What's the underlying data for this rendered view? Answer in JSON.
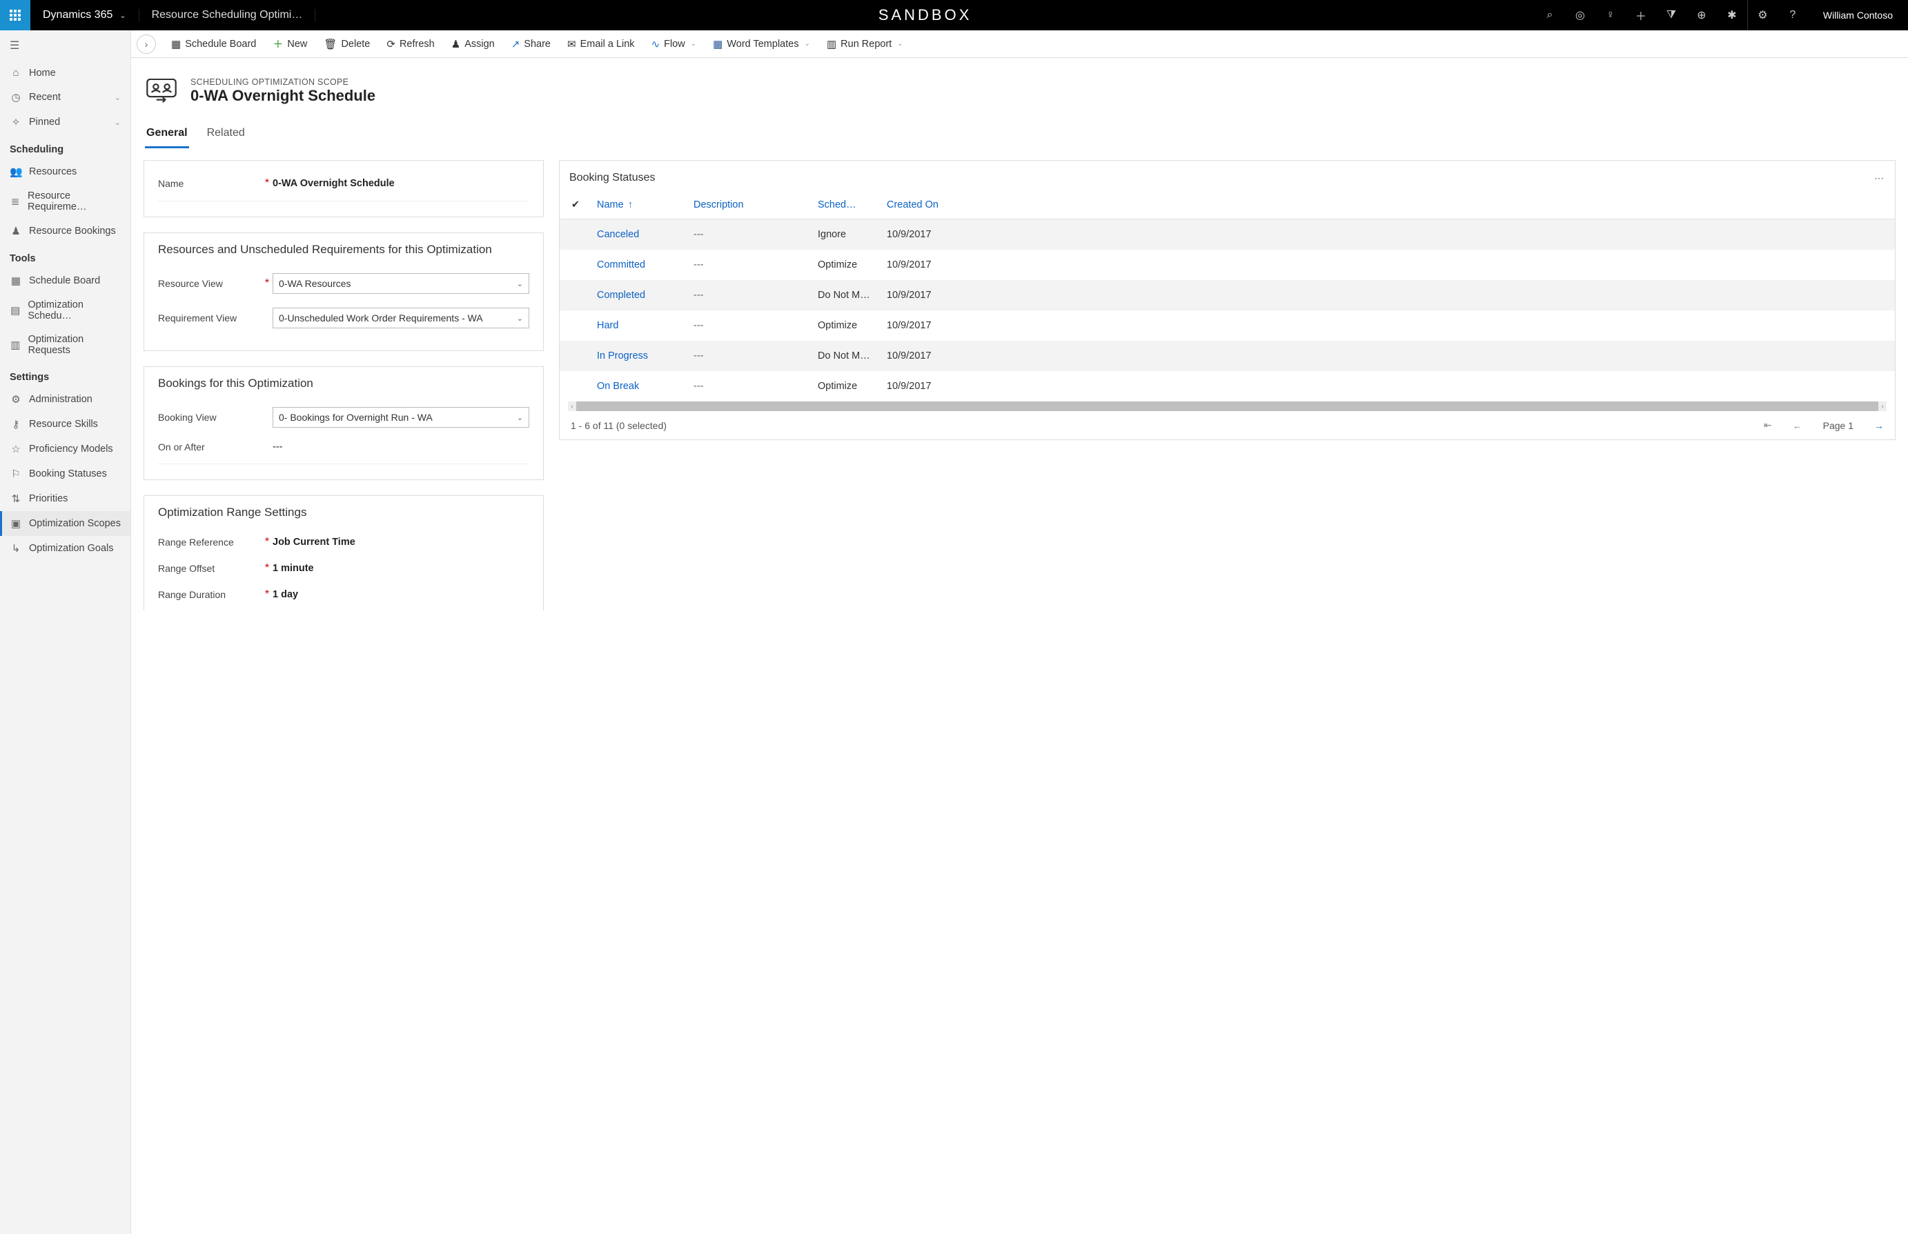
{
  "topbar": {
    "brand": "Dynamics 365",
    "breadcrumb": "Resource Scheduling Optimi…",
    "env": "SANDBOX",
    "user": "William Contoso"
  },
  "cmdbar": {
    "schedule_board": "Schedule Board",
    "new": "New",
    "delete": "Delete",
    "refresh": "Refresh",
    "assign": "Assign",
    "share": "Share",
    "email_link": "Email a Link",
    "flow": "Flow",
    "word_templates": "Word Templates",
    "run_report": "Run Report"
  },
  "nav": {
    "home": "Home",
    "recent": "Recent",
    "pinned": "Pinned",
    "group_scheduling": "Scheduling",
    "resources": "Resources",
    "resource_requirements": "Resource Requireme…",
    "resource_bookings": "Resource Bookings",
    "group_tools": "Tools",
    "schedule_board": "Schedule Board",
    "optimization_schedules": "Optimization Schedu…",
    "optimization_requests": "Optimization Requests",
    "group_settings": "Settings",
    "administration": "Administration",
    "resource_skills": "Resource Skills",
    "proficiency_models": "Proficiency Models",
    "booking_statuses": "Booking Statuses",
    "priorities": "Priorities",
    "optimization_scopes": "Optimization Scopes",
    "optimization_goals": "Optimization Goals"
  },
  "record": {
    "entity": "SCHEDULING OPTIMIZATION SCOPE",
    "title": "0-WA Overnight Schedule"
  },
  "tabs": {
    "general": "General",
    "related": "Related"
  },
  "form": {
    "name_label": "Name",
    "name_value": "0-WA Overnight Schedule",
    "sec_resources_title": "Resources and Unscheduled Requirements for this Optimization",
    "resource_view_label": "Resource View",
    "resource_view_value": "0-WA Resources",
    "requirement_view_label": "Requirement View",
    "requirement_view_value": "0-Unscheduled Work Order Requirements - WA",
    "sec_bookings_title": "Bookings for this Optimization",
    "booking_view_label": "Booking View",
    "booking_view_value": "0- Bookings for Overnight Run - WA",
    "on_or_after_label": "On or After",
    "on_or_after_value": "---",
    "sec_range_title": "Optimization Range Settings",
    "range_ref_label": "Range Reference",
    "range_ref_value": "Job Current Time",
    "range_offset_label": "Range Offset",
    "range_offset_value": "1 minute",
    "range_duration_label": "Range Duration",
    "range_duration_value": "1 day"
  },
  "subgrid": {
    "title": "Booking Statuses",
    "col_name": "Name",
    "col_desc": "Description",
    "col_sched": "Sched…",
    "col_created": "Created On",
    "rows": [
      {
        "name": "Canceled",
        "desc": "---",
        "sched": "Ignore",
        "created": "10/9/2017"
      },
      {
        "name": "Committed",
        "desc": "---",
        "sched": "Optimize",
        "created": "10/9/2017"
      },
      {
        "name": "Completed",
        "desc": "---",
        "sched": "Do Not M…",
        "created": "10/9/2017"
      },
      {
        "name": "Hard",
        "desc": "---",
        "sched": "Optimize",
        "created": "10/9/2017"
      },
      {
        "name": "In Progress",
        "desc": "---",
        "sched": "Do Not M…",
        "created": "10/9/2017"
      },
      {
        "name": "On Break",
        "desc": "---",
        "sched": "Optimize",
        "created": "10/9/2017"
      }
    ],
    "footer_count": "1 - 6 of 11 (0 selected)",
    "page_label": "Page 1"
  }
}
